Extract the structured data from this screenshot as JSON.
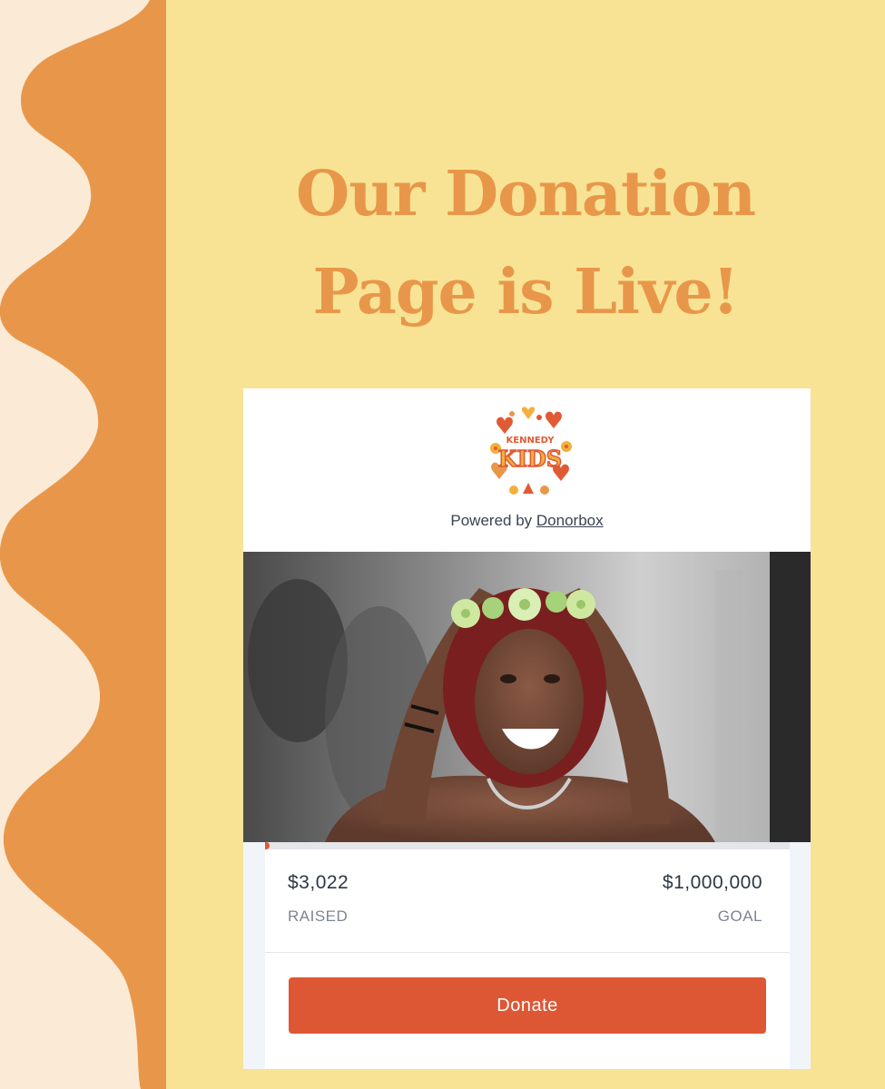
{
  "headline": {
    "line1": "Our Donation",
    "line2": "Page is Live!"
  },
  "logo": {
    "top_text": "KENNEDY",
    "main_text": "KIDS"
  },
  "powered_by": {
    "prefix": "Powered by ",
    "link": "Donorbox"
  },
  "stats": {
    "raised_value": "$3,022",
    "raised_label": "RAISED",
    "goal_value": "$1,000,000",
    "goal_label": "GOAL",
    "progress_fraction": 0.003022
  },
  "donate_button": {
    "label": "Donate"
  },
  "colors": {
    "background": "#f8e394",
    "wave_orange": "#e8974a",
    "wave_cream": "#fbead6",
    "headline": "#e8974a",
    "button": "#dd5734"
  }
}
